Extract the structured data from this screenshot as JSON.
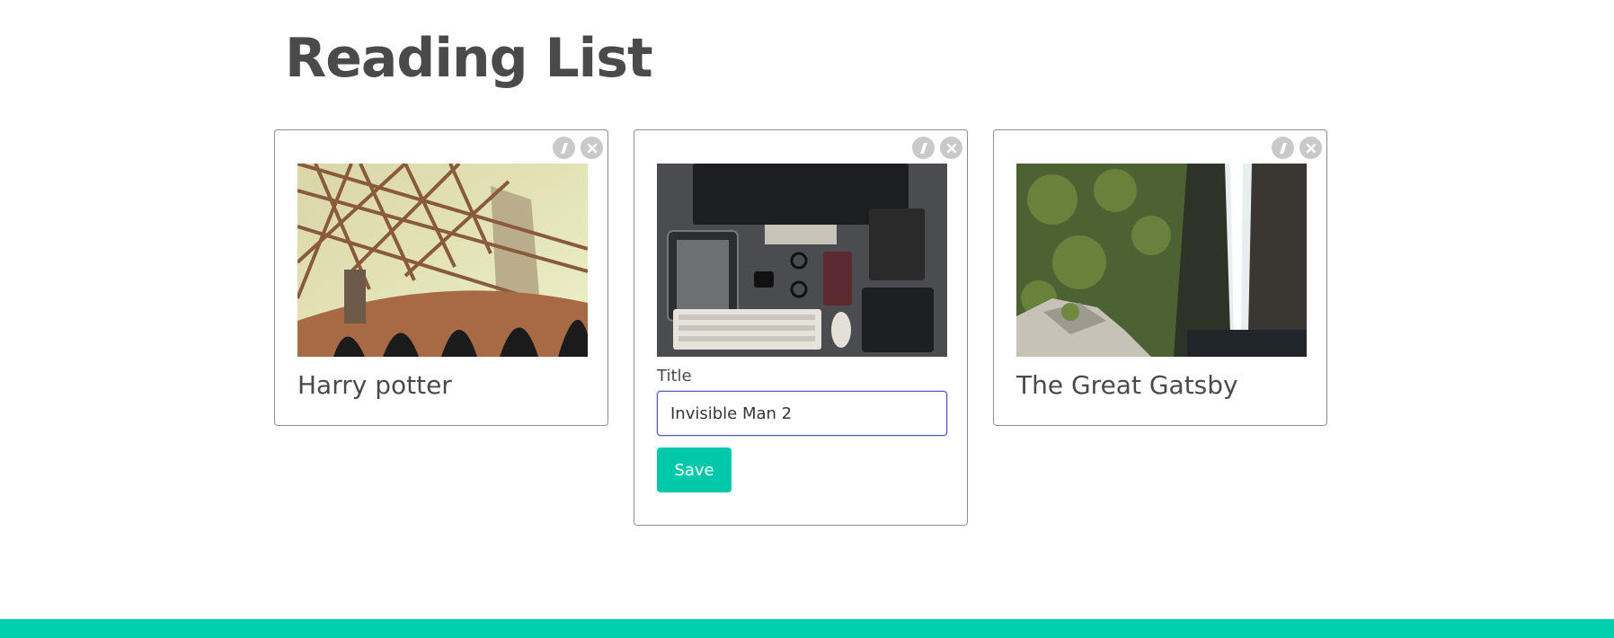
{
  "page": {
    "title": "Reading List"
  },
  "colors": {
    "accent": "#00c9aa",
    "footer": "#00cfad",
    "text": "#4a4a4a",
    "card_border": "#8f8f8f",
    "input_focus": "#4f56c6",
    "action_icon_bg": "#c9c9c9"
  },
  "books": [
    {
      "title": "Harry potter",
      "image": "bridge-steel-truss",
      "actions": [
        "edit-icon",
        "delete-icon"
      ]
    },
    {
      "editing": true,
      "image": "desk-computer-flatlay",
      "form": {
        "label": "Title",
        "value": "Invisible Man 2",
        "save_label": "Save"
      },
      "actions": [
        "edit-icon",
        "delete-icon"
      ]
    },
    {
      "title": "The Great Gatsby",
      "image": "waterfall-rocks",
      "actions": [
        "edit-icon",
        "delete-icon"
      ]
    }
  ]
}
